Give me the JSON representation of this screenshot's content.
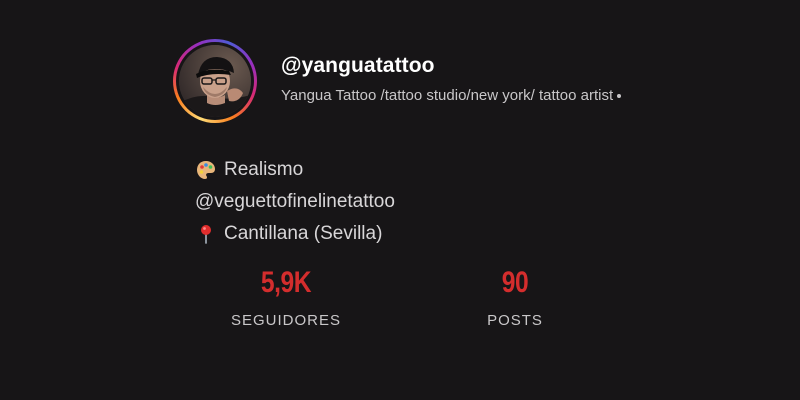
{
  "profile": {
    "username": "@yanguatattoo",
    "bio": "Yangua Tattoo /tattoo studio/new york/ tattoo artist",
    "details": [
      {
        "icon": "artist-palette-icon",
        "text": "Realismo"
      },
      {
        "icon": "",
        "text": "@veguettofinelinetattoo"
      },
      {
        "icon": "round-pushpin-icon",
        "text": "Cantillana (Sevilla)"
      }
    ]
  },
  "stats": [
    {
      "value": "5,9K",
      "label": "SEGUIDORES"
    },
    {
      "value": "90",
      "label": "POSTS"
    }
  ],
  "colors": {
    "background": "#171517",
    "accent": "#d42d2d",
    "text_primary": "#ffffff",
    "text_secondary": "#c9c7c9"
  }
}
